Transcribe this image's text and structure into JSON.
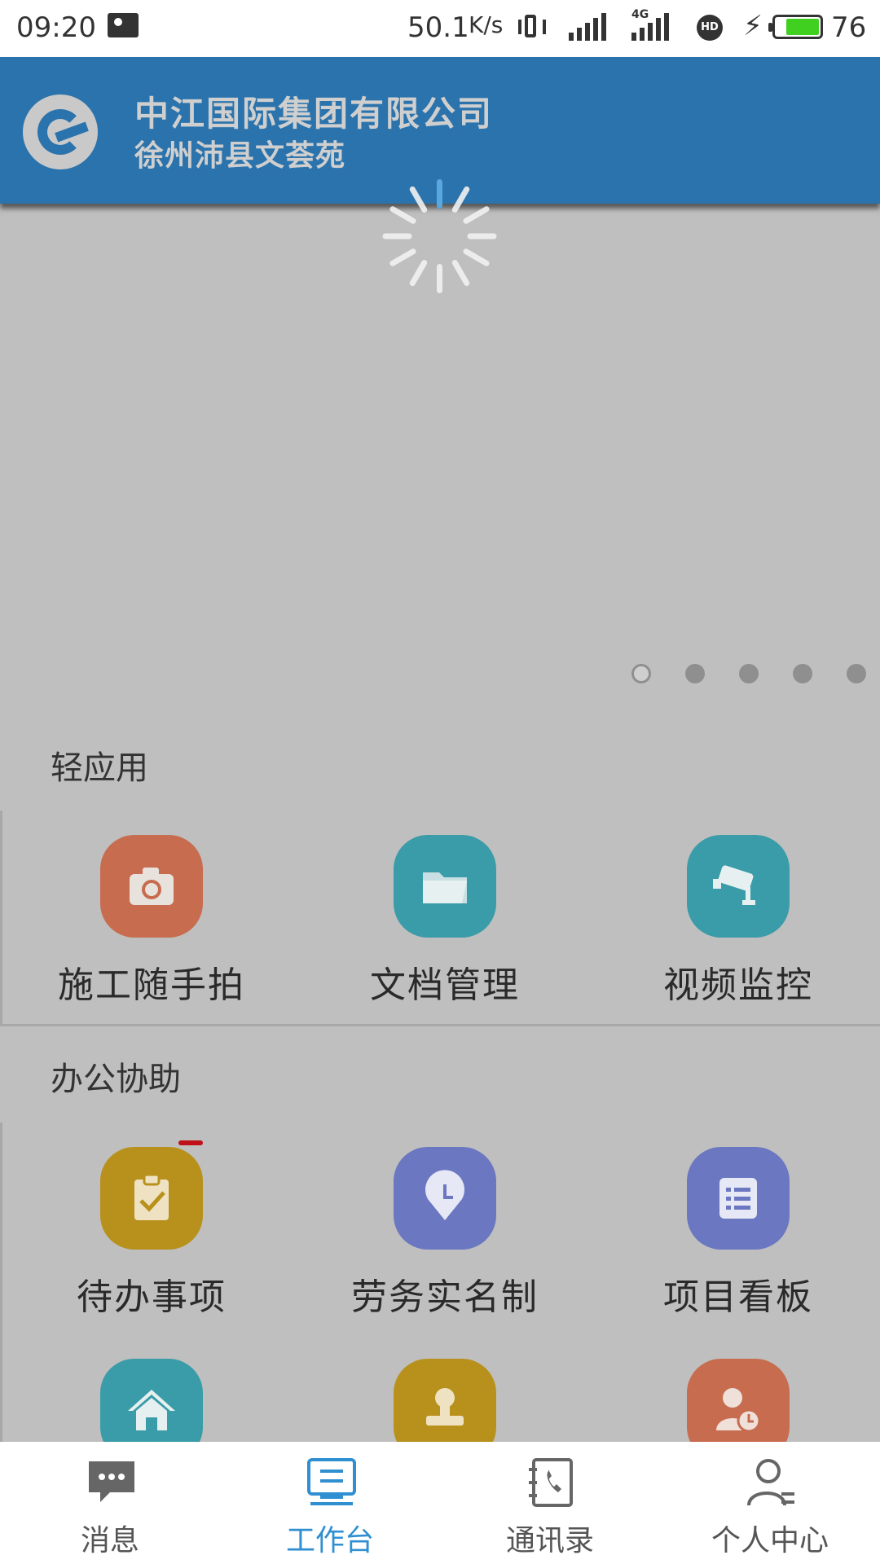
{
  "status_bar": {
    "time": "09:20",
    "network_speed": "50.1",
    "network_speed_unit": "K/s",
    "network_type": "4G",
    "hd_label": "HD",
    "battery_level": "76",
    "battery_fraction": 0.76,
    "battery_color": "#3fd020"
  },
  "header": {
    "company_name": "中江国际集团有限公司",
    "project_name": "徐州沛县文荟苑",
    "background_color": "#2b73ac",
    "logo_icon": "company-logo"
  },
  "carousel": {
    "loading": true,
    "slide_count": 5,
    "active_index": 0
  },
  "sections": [
    {
      "title": "轻应用",
      "apps": [
        {
          "label": "施工随手拍",
          "icon": "camera-icon",
          "color": "#c76c4e"
        },
        {
          "label": "文档管理",
          "icon": "folder-icon",
          "color": "#3a9ca8"
        },
        {
          "label": "视频监控",
          "icon": "cctv-camera-icon",
          "color": "#3a9ca8"
        }
      ]
    },
    {
      "title": "办公协助",
      "apps": [
        {
          "label": "待办事项",
          "icon": "clipboard-check-icon",
          "color": "#b8901c"
        },
        {
          "label": "劳务实名制",
          "icon": "location-clock-icon",
          "color": "#6b77c1"
        },
        {
          "label": "项目看板",
          "icon": "list-board-icon",
          "color": "#6b77c1"
        },
        {
          "label": "",
          "icon": "home-icon",
          "color": "#3a9ca8"
        },
        {
          "label": "",
          "icon": "stamp-icon",
          "color": "#b8901c"
        },
        {
          "label": "",
          "icon": "user-clock-icon",
          "color": "#c76c4e"
        }
      ]
    }
  ],
  "bottom_nav": {
    "active_color": "#2f8fd1",
    "items": [
      {
        "label": "消息",
        "icon": "chat-bubble-icon",
        "active": false
      },
      {
        "label": "工作台",
        "icon": "workbench-icon",
        "active": true
      },
      {
        "label": "通讯录",
        "icon": "contacts-book-icon",
        "active": false
      },
      {
        "label": "个人中心",
        "icon": "user-profile-icon",
        "active": false
      }
    ]
  }
}
